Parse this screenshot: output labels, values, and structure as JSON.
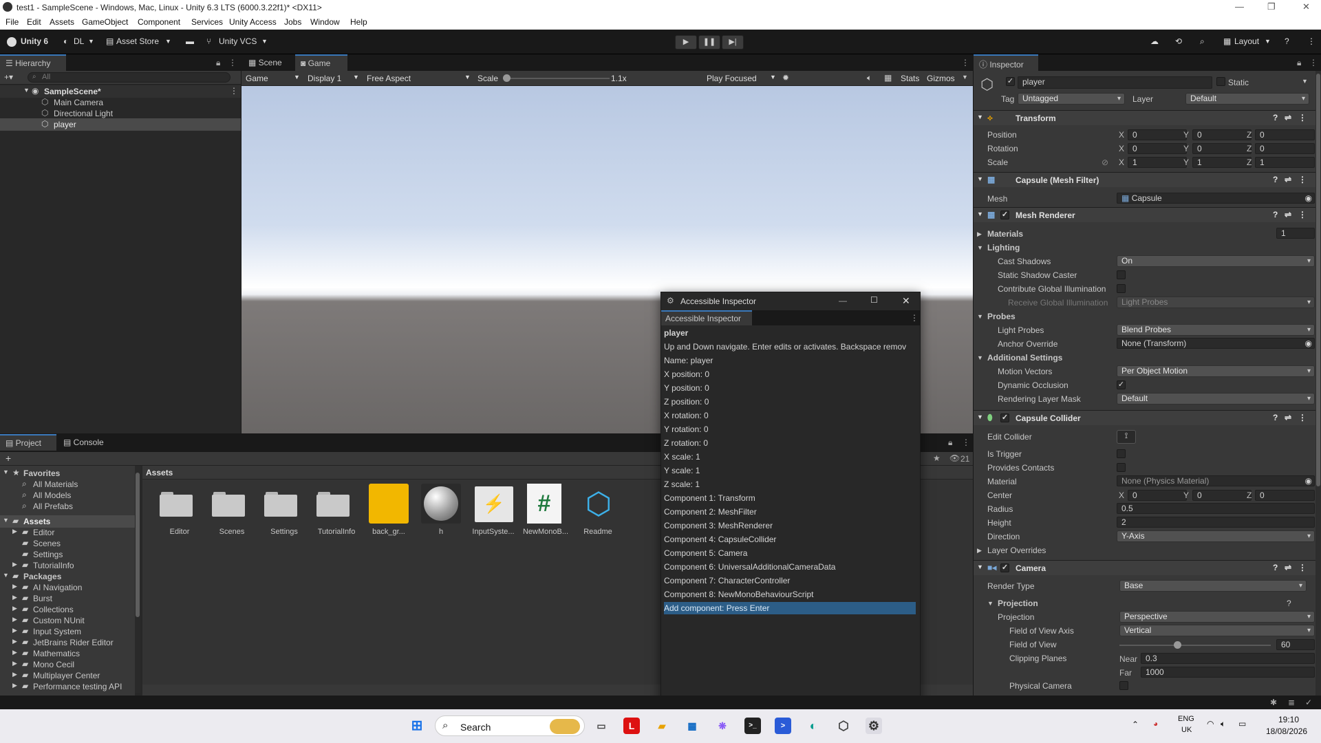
{
  "window": {
    "title": "test1 - SampleScene - Windows, Mac, Linux - Unity 6.3 LTS (6000.3.22f1)* <DX11>"
  },
  "menu": [
    "File",
    "Edit",
    "Assets",
    "GameObject",
    "Component",
    "Services",
    "Unity Access",
    "Jobs",
    "Window",
    "Help"
  ],
  "toolbar": {
    "unity": "Unity 6",
    "account": "DL",
    "asset_store": "Asset Store",
    "vcs": "Unity VCS",
    "layout": "Layout"
  },
  "hierarchy": {
    "tab": "Hierarchy",
    "search_placeholder": "All",
    "scene": "SampleScene*",
    "items": [
      "Main Camera",
      "Directional Light",
      "player"
    ]
  },
  "game": {
    "tabs": [
      "Scene",
      "Game"
    ],
    "mode": "Game",
    "display": "Display 1",
    "aspect": "Free Aspect",
    "scale_label": "Scale",
    "scale_value": "1.1x",
    "scale_fraction": 0.03,
    "play_focused": "Play Focused",
    "stats": "Stats",
    "gizmos": "Gizmos"
  },
  "project": {
    "tabs": [
      "Project",
      "Console"
    ],
    "hidden_count": "21",
    "favorites_label": "Favorites",
    "favorites": [
      "All Materials",
      "All Models",
      "All Prefabs"
    ],
    "assets_label": "Assets",
    "assets_tree": [
      "Editor",
      "Scenes",
      "Settings",
      "TutorialInfo"
    ],
    "packages_label": "Packages",
    "packages": [
      "AI Navigation",
      "Burst",
      "Collections",
      "Custom NUnit",
      "Input System",
      "JetBrains Rider Editor",
      "Mathematics",
      "Mono Cecil",
      "Multiplayer Center",
      "Performance testing API"
    ],
    "breadcrumb": "Assets",
    "grid": [
      {
        "label": "Editor",
        "icon": "folder-icon"
      },
      {
        "label": "Scenes",
        "icon": "folder-icon"
      },
      {
        "label": "Settings",
        "icon": "folder-icon"
      },
      {
        "label": "TutorialInfo",
        "icon": "folder-icon"
      },
      {
        "label": "back_gr...",
        "icon": "audio-clip-icon"
      },
      {
        "label": "h",
        "icon": "material-sphere-icon"
      },
      {
        "label": "InputSyste...",
        "icon": "input-actions-icon"
      },
      {
        "label": "NewMonoB...",
        "icon": "csharp-script-icon"
      },
      {
        "label": "Readme",
        "icon": "readme-asset-icon"
      }
    ]
  },
  "inspector": {
    "tab": "Inspector",
    "name": "player",
    "static": "Static",
    "tag_label": "Tag",
    "tag": "Untagged",
    "layer_label": "Layer",
    "layer": "Default",
    "transform": {
      "title": "Transform",
      "position_label": "Position",
      "position": [
        "0",
        "0",
        "0"
      ],
      "rotation_label": "Rotation",
      "rotation": [
        "0",
        "0",
        "0"
      ],
      "scale_label": "Scale",
      "scale": [
        "1",
        "1",
        "1"
      ]
    },
    "mesh_filter": {
      "title": "Capsule (Mesh Filter)",
      "mesh_label": "Mesh",
      "mesh": "Capsule"
    },
    "mesh_renderer": {
      "title": "Mesh Renderer",
      "materials_label": "Materials",
      "materials_count": "1",
      "lighting_label": "Lighting",
      "cast_shadows_label": "Cast Shadows",
      "cast_shadows": "On",
      "static_shadow_label": "Static Shadow Caster",
      "contribute_gi_label": "Contribute Global Illumination",
      "receive_gi_label": "Receive Global Illumination",
      "receive_gi": "Light Probes",
      "probes_label": "Probes",
      "light_probes_label": "Light Probes",
      "light_probes": "Blend Probes",
      "anchor_label": "Anchor Override",
      "anchor": "None (Transform)",
      "additional_label": "Additional Settings",
      "motion_vectors_label": "Motion Vectors",
      "motion_vectors": "Per Object Motion",
      "dynamic_occlusion_label": "Dynamic Occlusion",
      "rendering_layer_label": "Rendering Layer Mask",
      "rendering_layer": "Default"
    },
    "capsule_collider": {
      "title": "Capsule Collider",
      "edit_label": "Edit Collider",
      "is_trigger_label": "Is Trigger",
      "provides_contacts_label": "Provides Contacts",
      "material_label": "Material",
      "material": "None (Physics Material)",
      "center_label": "Center",
      "center": [
        "0",
        "0",
        "0"
      ],
      "radius_label": "Radius",
      "radius": "0.5",
      "height_label": "Height",
      "height": "2",
      "direction_label": "Direction",
      "direction": "Y-Axis",
      "layer_overrides_label": "Layer Overrides"
    },
    "camera": {
      "title": "Camera",
      "render_type_label": "Render Type",
      "render_type": "Base",
      "projection_section": "Projection",
      "projection_label": "Projection",
      "projection": "Perspective",
      "fov_axis_label": "Field of View Axis",
      "fov_axis": "Vertical",
      "fov_label": "Field of View",
      "fov": "60",
      "fov_fraction": 0.38,
      "clipping_label": "Clipping Planes",
      "near_label": "Near",
      "near": "0.3",
      "far_label": "Far",
      "far": "1000",
      "physical_label": "Physical Camera"
    }
  },
  "accessible_inspector": {
    "title": "Accessible Inspector",
    "tab": "Accessible Inspector",
    "lines": [
      "player",
      "Up and Down navigate. Enter edits or activates. Backspace remov",
      "Name: player",
      "X position: 0",
      "Y position: 0",
      "Z position: 0",
      "X rotation: 0",
      "Y rotation: 0",
      "Z rotation: 0",
      "X scale: 1",
      "Y scale: 1",
      "Z scale: 1",
      "Component 1: Transform",
      "Component 2: MeshFilter",
      "Component 3: MeshRenderer",
      "Component 4: CapsuleCollider",
      "Component 5: Camera",
      "Component 6: UniversalAdditionalCameraData",
      "Component 7: CharacterController",
      "Component 8: NewMonoBehaviourScript",
      "Add component: Press Enter"
    ]
  },
  "taskbar": {
    "search": "Search",
    "lang1": "ENG",
    "lang2": "UK",
    "time": "19:10",
    "date": "18/08/2026"
  }
}
